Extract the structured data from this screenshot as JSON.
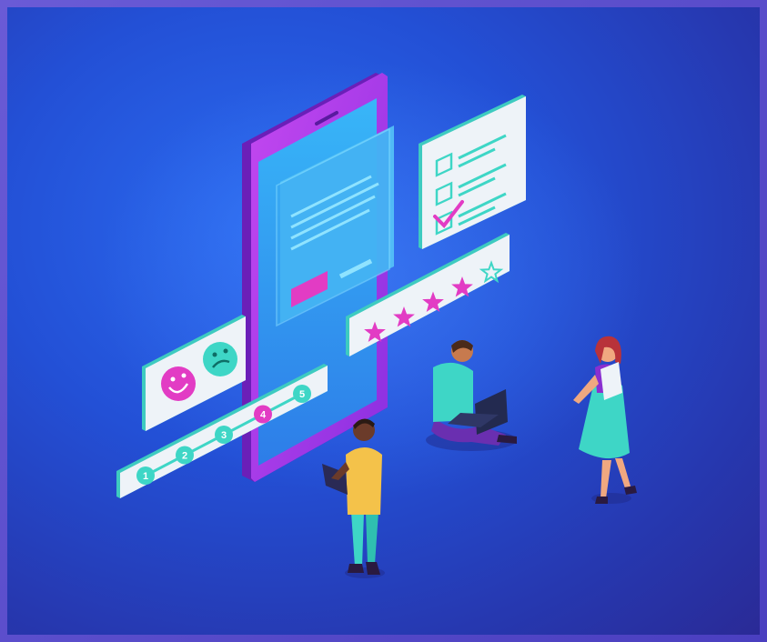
{
  "scene": {
    "palette": {
      "background": "#2350d6",
      "phone_body": "#b03cf0",
      "phone_screen": "#37a6f5",
      "card": "#eef3f8",
      "accent_teal": "#3ed6c6",
      "accent_pink": "#e23cc4"
    },
    "rating": {
      "filled_stars": 4,
      "total_stars": 5
    },
    "progress_steps": [
      "1",
      "2",
      "3",
      "4",
      "5"
    ],
    "progress_active_step": "4",
    "checklist": {
      "items": 3,
      "checked": 1
    }
  }
}
